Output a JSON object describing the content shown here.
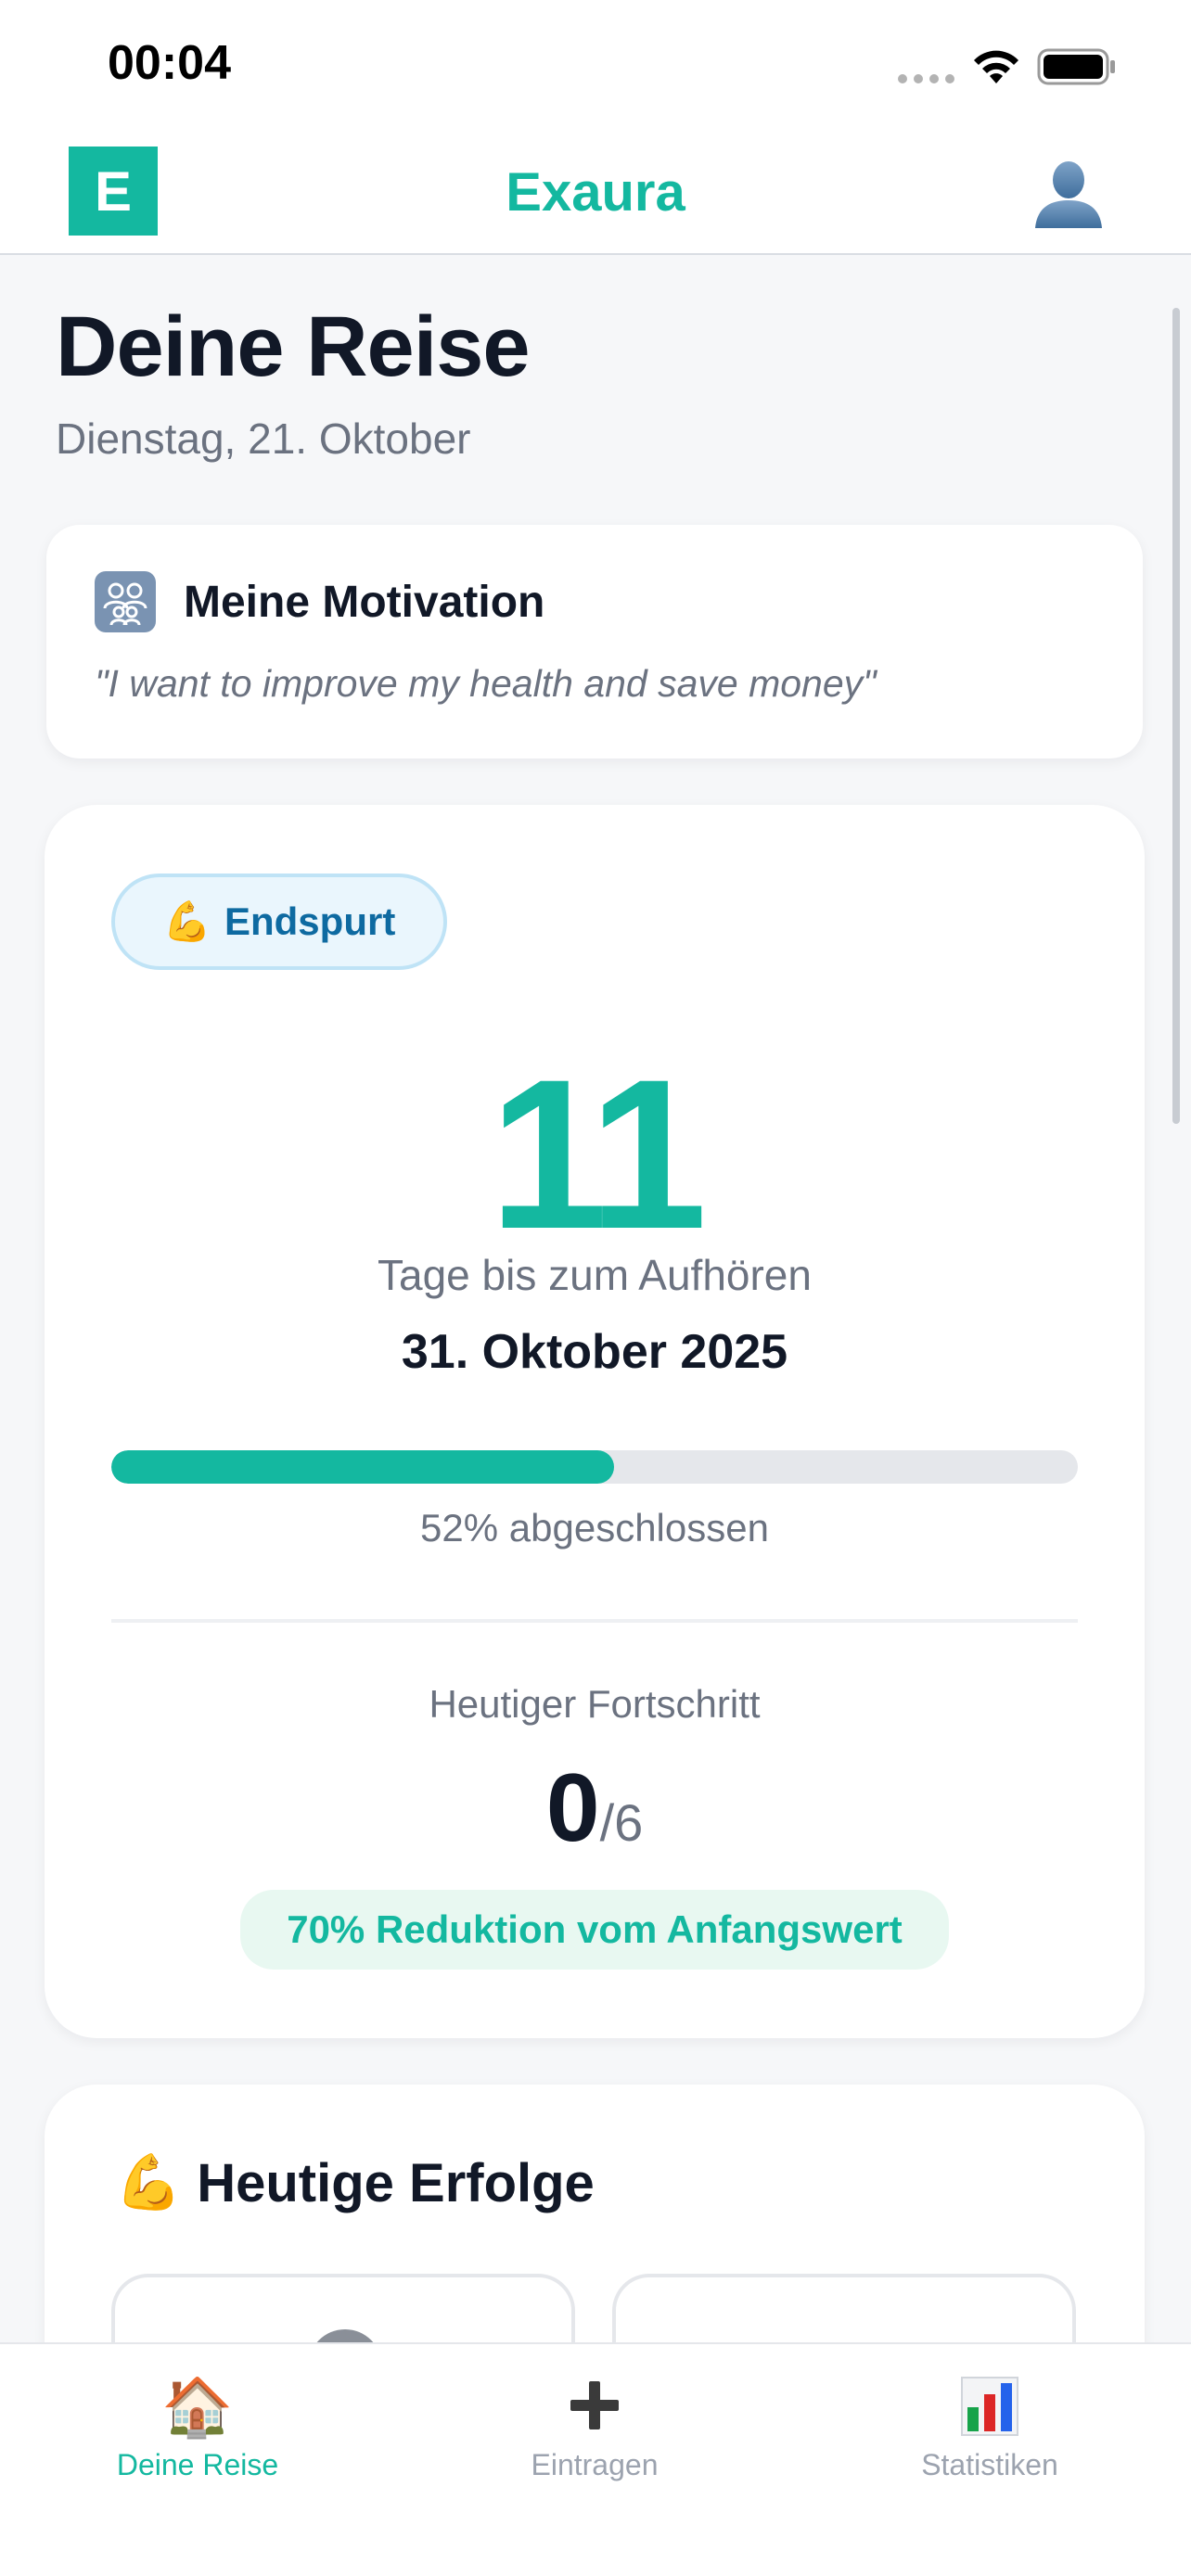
{
  "status_bar": {
    "time": "00:04"
  },
  "header": {
    "logo_letter": "E",
    "app_name": "Exaura",
    "profile_icon": "person-silhouette-icon"
  },
  "page": {
    "title": "Deine Reise",
    "date": "Dienstag, 21. Oktober"
  },
  "motivation": {
    "icon": "family-icon",
    "title": "Meine Motivation",
    "quote": "\"I want to improve my health and save money\""
  },
  "countdown": {
    "phase_emoji": "💪",
    "phase_label": "Endspurt",
    "days_remaining": "11",
    "days_label": "Tage bis zum Aufhören",
    "quit_date": "31. Oktober 2025",
    "progress_percent": 52,
    "progress_label": "52% abgeschlossen",
    "today_label": "Heutiger Fortschritt",
    "today_count": "0",
    "today_total": "/6",
    "reduction_label": "70% Reduktion vom Anfangswert"
  },
  "achievements": {
    "emoji": "💪",
    "title": "Heutige Erfolge"
  },
  "tab_bar": {
    "tabs": [
      {
        "icon": "house-icon",
        "emoji": "🏠",
        "label": "Deine Reise",
        "active": true
      },
      {
        "icon": "plus-icon",
        "emoji": "+",
        "label": "Eintragen",
        "active": false
      },
      {
        "icon": "bar-chart-icon",
        "emoji": "📊",
        "label": "Statistiken",
        "active": false
      }
    ]
  },
  "colors": {
    "accent": "#14b8a0",
    "badge_blue": "#0e6aa1",
    "text_primary": "#111827",
    "text_secondary": "#6b7280"
  }
}
